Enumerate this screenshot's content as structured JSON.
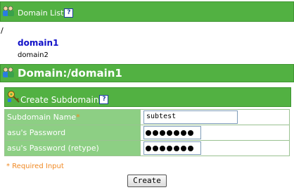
{
  "domain_list": {
    "title": "Domain List",
    "root": "/",
    "items": [
      "domain1",
      "domain2"
    ],
    "help": "?"
  },
  "domain_header": {
    "title": "Domain:/domain1"
  },
  "subdomain": {
    "title": "Create Subdomain",
    "help": "?"
  },
  "form": {
    "rows": [
      {
        "label": "Subdomain Name",
        "required_mark": "*",
        "value": "subtest"
      },
      {
        "label": "asu's Password",
        "masked_length": 7
      },
      {
        "label": "asu's Password (retype)",
        "masked_length": 7
      }
    ],
    "required_note": "* Required Input",
    "submit_label": "Create"
  },
  "colors": {
    "header_green": "#52b142",
    "label_green": "#8dcf84",
    "required_orange": "#f08a24",
    "link_blue": "#1010c8"
  },
  "icons": [
    "users-icon",
    "key-icon",
    "help-icon"
  ]
}
